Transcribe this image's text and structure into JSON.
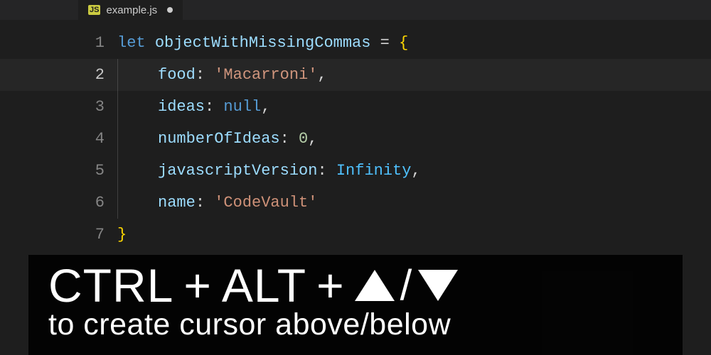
{
  "tab": {
    "language_badge": "JS",
    "filename": "example.js",
    "dirty": true
  },
  "editor": {
    "active_line": 2,
    "lines": [
      {
        "num": "1",
        "tokens": [
          {
            "t": "let ",
            "c": "tk-keyword"
          },
          {
            "t": "objectWithMissingCommas",
            "c": "tk-var"
          },
          {
            "t": " ",
            "c": "tk-punc"
          },
          {
            "t": "=",
            "c": "tk-punc"
          },
          {
            "t": " ",
            "c": "tk-punc"
          },
          {
            "t": "{",
            "c": "tk-brace"
          }
        ]
      },
      {
        "num": "2",
        "indent": 1,
        "tokens": [
          {
            "t": "food",
            "c": "tk-prop"
          },
          {
            "t": ": ",
            "c": "tk-punc"
          },
          {
            "t": "'Macarroni'",
            "c": "tk-string"
          },
          {
            "t": ",",
            "c": "tk-punc"
          }
        ]
      },
      {
        "num": "3",
        "indent": 1,
        "tokens": [
          {
            "t": "ideas",
            "c": "tk-prop"
          },
          {
            "t": ": ",
            "c": "tk-punc"
          },
          {
            "t": "null",
            "c": "tk-null"
          },
          {
            "t": ",",
            "c": "tk-punc"
          }
        ]
      },
      {
        "num": "4",
        "indent": 1,
        "tokens": [
          {
            "t": "numberOfIdeas",
            "c": "tk-prop"
          },
          {
            "t": ": ",
            "c": "tk-punc"
          },
          {
            "t": "0",
            "c": "tk-num"
          },
          {
            "t": ",",
            "c": "tk-punc"
          }
        ]
      },
      {
        "num": "5",
        "indent": 1,
        "tokens": [
          {
            "t": "javascriptVersion",
            "c": "tk-prop"
          },
          {
            "t": ": ",
            "c": "tk-punc"
          },
          {
            "t": "Infinity",
            "c": "tk-const"
          },
          {
            "t": ",",
            "c": "tk-punc"
          }
        ]
      },
      {
        "num": "6",
        "indent": 1,
        "tokens": [
          {
            "t": "name",
            "c": "tk-prop"
          },
          {
            "t": ": ",
            "c": "tk-punc"
          },
          {
            "t": "'CodeVault'",
            "c": "tk-string"
          }
        ]
      },
      {
        "num": "7",
        "tokens": [
          {
            "t": "}",
            "c": "tk-brace"
          }
        ]
      }
    ]
  },
  "caption": {
    "key1": "CTRL",
    "plus1": "+",
    "key2": "ALT",
    "plus2": "+",
    "slash": "/",
    "subtitle": "to create cursor above/below"
  }
}
